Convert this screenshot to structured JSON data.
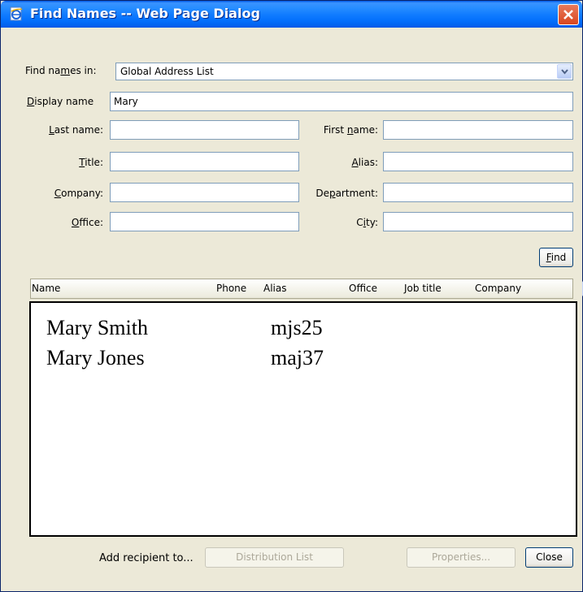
{
  "window": {
    "title": "Find Names -- Web Page Dialog"
  },
  "form": {
    "find_in_label": "Find names in:",
    "find_in_value": "Global Address List",
    "display_name_label": "Display name",
    "display_name_value": "Mary",
    "last_name_label": "Last name:",
    "first_name_label": "First name:",
    "title_label": "Title:",
    "alias_label": "Alias:",
    "company_label": "Company:",
    "department_label": "Department:",
    "office_label": "Office:",
    "city_label": "City:",
    "find_button": "Find"
  },
  "results": {
    "columns": [
      "Name",
      "Phone",
      "Alias",
      "Office",
      "Job title",
      "Company"
    ],
    "rows": [
      {
        "name": "Mary Smith",
        "alias": "mjs25"
      },
      {
        "name": "Mary Jones",
        "alias": "maj37"
      }
    ]
  },
  "footer": {
    "add_recipient_label": "Add recipient to...",
    "distribution_list_button": "Distribution List",
    "properties_button": "Properties...",
    "close_button": "Close"
  },
  "icons": {
    "title_icon": "ie-page-icon",
    "close": "close-icon",
    "dropdown": "chevron-down-icon",
    "scroll": "chevron-up-icon"
  },
  "colors": {
    "titlebar": "#0058E6",
    "dialog_bg": "#ECE9D8",
    "close_button": "#D9461F",
    "input_border": "#7F9DB9"
  }
}
